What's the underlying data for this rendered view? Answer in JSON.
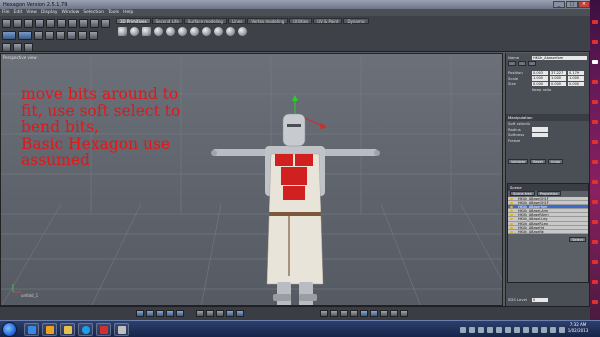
{
  "window": {
    "title": "Hexagon Version 2.5.1.79"
  },
  "menu": [
    "File",
    "Edit",
    "View",
    "Display",
    "Window",
    "Selection",
    "Tools",
    "Help"
  ],
  "tabs": [
    {
      "label": "3D Primitives",
      "active": true
    },
    {
      "label": "Second Life",
      "active": false
    },
    {
      "label": "Surface modeling",
      "active": false
    },
    {
      "label": "Lines",
      "active": false
    },
    {
      "label": "Vertex modeling",
      "active": false
    },
    {
      "label": "Utilities",
      "active": false
    },
    {
      "label": "UV & Paint",
      "active": false
    },
    {
      "label": "Dynamic",
      "active": false
    }
  ],
  "viewport": {
    "label": "Perspective view",
    "annotation": [
      "move bits around to",
      "fit, use soft select to",
      "bend bits,",
      "Basic Hexagon use",
      "assumed"
    ],
    "axis_label": "unfold_1",
    "annotation_color": "#e01818"
  },
  "panel": {
    "name_label": "Name",
    "name_value": "HKUk_Abaserfom",
    "rows": [
      {
        "label": "Position",
        "values": [
          "0.003",
          "37.227",
          "0.179"
        ]
      },
      {
        "label": "Scale",
        "values": [
          "1.000",
          "1.000",
          "1.000"
        ]
      },
      {
        "label": "Size",
        "values": [
          "0.000",
          "0.000",
          "0.000"
        ]
      }
    ],
    "keep_ratio": "Keep ratio",
    "manipulation": "Manipulation",
    "soft_selection": "Soft selection",
    "radius_label": "Radius",
    "softness_label": "Softness",
    "freeze_label": "Freeze",
    "buttons": [
      "Validate",
      "Reset",
      "Undo"
    ],
    "scene_tab": "Scene",
    "scene_tabs": [
      "Scene tree",
      "Properties"
    ],
    "scene_items": [
      "HKUk_ABaseGH1F",
      "HKUk_ABaseGH1F",
      "HKUk_ABaserfom",
      "HKUk_ABaseLArm",
      "HKUk_ABaseRArm",
      "HKUk_ABaseLLeg",
      "HKUk_ABaseRLeg",
      "HKUk_ABaseHd",
      "HKUk_ABaseNk"
    ],
    "selected_scene_index": 2,
    "select_btn": "Select",
    "status_left": "SDS Level",
    "status_value": "0"
  },
  "taskbar": {
    "time": "7:32 AM",
    "date": "1/02/2013"
  }
}
